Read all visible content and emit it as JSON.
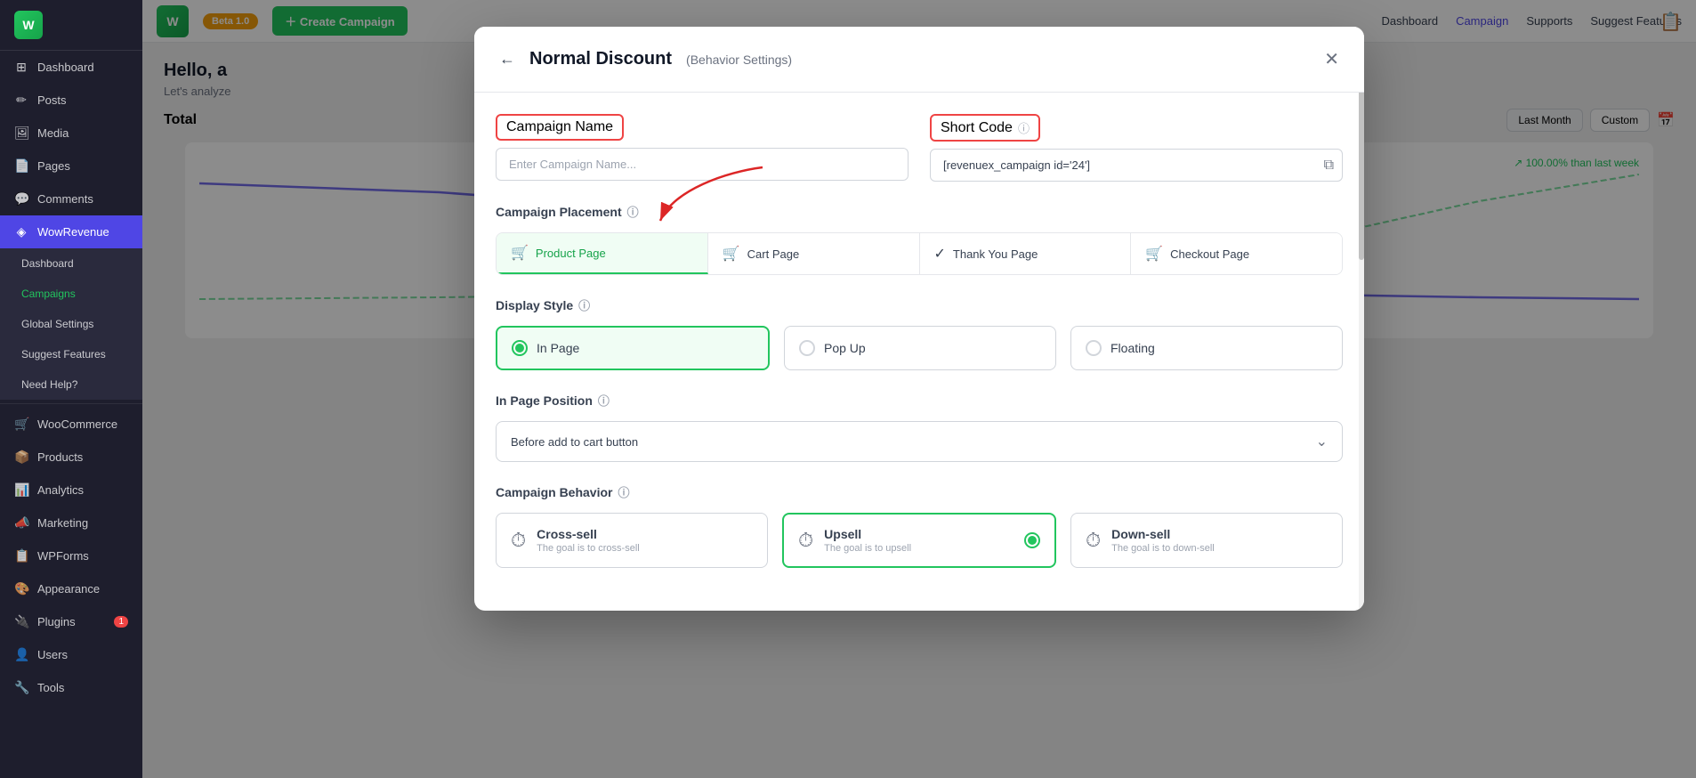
{
  "sidebar": {
    "logo_text": "W",
    "items": [
      {
        "id": "dashboard",
        "label": "Dashboard",
        "icon": "⊞",
        "active": false
      },
      {
        "id": "posts",
        "label": "Posts",
        "icon": "📝",
        "active": false
      },
      {
        "id": "media",
        "label": "Media",
        "icon": "🖼",
        "active": false
      },
      {
        "id": "pages",
        "label": "Pages",
        "icon": "📄",
        "active": false
      },
      {
        "id": "comments",
        "label": "Comments",
        "icon": "💬",
        "active": false
      },
      {
        "id": "wowrevenue",
        "label": "WowRevenue",
        "icon": "◈",
        "active": true
      },
      {
        "id": "sub-dashboard",
        "label": "Dashboard",
        "icon": "",
        "active": false
      },
      {
        "id": "sub-campaigns",
        "label": "Campaigns",
        "icon": "",
        "active": false
      },
      {
        "id": "sub-global-settings",
        "label": "Global Settings",
        "icon": "",
        "active": false
      },
      {
        "id": "sub-suggest-features",
        "label": "Suggest Features",
        "icon": "",
        "active": false
      },
      {
        "id": "sub-need-help",
        "label": "Need Help?",
        "icon": "",
        "active": false
      },
      {
        "id": "woocommerce",
        "label": "WooCommerce",
        "icon": "🛒",
        "active": false
      },
      {
        "id": "products",
        "label": "Products",
        "icon": "📦",
        "active": false
      },
      {
        "id": "analytics",
        "label": "Analytics",
        "icon": "📊",
        "active": false
      },
      {
        "id": "marketing",
        "label": "Marketing",
        "icon": "📣",
        "active": false
      },
      {
        "id": "wpforms",
        "label": "WPForms",
        "icon": "📋",
        "active": false
      },
      {
        "id": "appearance",
        "label": "Appearance",
        "icon": "🎨",
        "active": false
      },
      {
        "id": "plugins",
        "label": "Plugins",
        "icon": "🔌",
        "active": false,
        "badge": "1"
      },
      {
        "id": "users",
        "label": "Users",
        "icon": "👤",
        "active": false
      },
      {
        "id": "tools",
        "label": "Tools",
        "icon": "🔧",
        "active": false
      }
    ]
  },
  "topbar": {
    "beta_label": "Beta 1.0",
    "create_campaign_label": "＋ Create Campaign",
    "nav_items": [
      {
        "id": "dashboard",
        "label": "Dashboard",
        "active": false
      },
      {
        "id": "campaign",
        "label": "Campaign",
        "active": true
      },
      {
        "id": "supports",
        "label": "Supports",
        "active": false
      },
      {
        "id": "suggest-features",
        "label": "Suggest Features",
        "active": false
      }
    ]
  },
  "page": {
    "greeting": "Hello, a",
    "subtitle": "Let's analyze",
    "total_label": "Total",
    "last_month_label": "Last Month",
    "custom_label": "Custom",
    "trend_label": "↗ 100.00% than last week"
  },
  "modal": {
    "back_icon": "←",
    "close_icon": "✕",
    "title": "Normal Discount",
    "subtitle": "(Behavior Settings)",
    "campaign_name_label": "Campaign Name",
    "campaign_name_placeholder": "Enter Campaign Name...",
    "short_code_label": "Short Code",
    "short_code_info_icon": "ⓘ",
    "short_code_value": "[revenuex_campaign id='24']",
    "copy_icon": "⧉",
    "campaign_placement_label": "Campaign Placement",
    "placement_info_icon": "ⓘ",
    "placement_tabs": [
      {
        "id": "product-page",
        "label": "Product Page",
        "icon": "🛒",
        "active": true
      },
      {
        "id": "cart-page",
        "label": "Cart Page",
        "icon": "🛒",
        "active": false
      },
      {
        "id": "thank-you-page",
        "label": "Thank You Page",
        "icon": "✓",
        "active": false
      },
      {
        "id": "checkout-page",
        "label": "Checkout Page",
        "icon": "🛒",
        "active": false
      }
    ],
    "display_style_label": "Display Style",
    "display_style_info_icon": "ⓘ",
    "display_options": [
      {
        "id": "in-page",
        "label": "In Page",
        "active": true
      },
      {
        "id": "pop-up",
        "label": "Pop Up",
        "active": false
      },
      {
        "id": "floating",
        "label": "Floating",
        "active": false
      }
    ],
    "in_page_position_label": "In Page Position",
    "in_page_position_info_icon": "ⓘ",
    "position_dropdown_value": "Before add to cart button",
    "campaign_behavior_label": "Campaign Behavior",
    "campaign_behavior_info_icon": "ⓘ",
    "behavior_options": [
      {
        "id": "cross-sell",
        "label": "Cross-sell",
        "desc": "The goal is to cross-sell",
        "icon": "⏱",
        "active": false
      },
      {
        "id": "upsell",
        "label": "Upsell",
        "desc": "The goal is to upsell",
        "icon": "⏱",
        "active": true
      },
      {
        "id": "down-sell",
        "label": "Down-sell",
        "desc": "The goal is to down-sell",
        "icon": "⏱",
        "active": false
      }
    ]
  }
}
